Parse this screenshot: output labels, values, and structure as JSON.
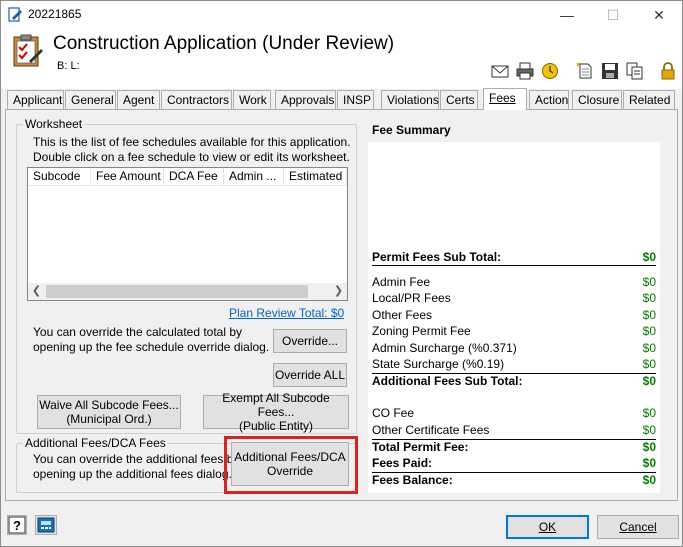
{
  "window": {
    "title": "20221865",
    "app_title": "Construction Application (Under Review)",
    "bl_label": "B: L:"
  },
  "toolbar_icons": [
    "envelope-icon",
    "printer-icon",
    "clock-icon",
    "new-document-icon",
    "save-icon",
    "copy-icon",
    "lock-icon"
  ],
  "tabs": [
    {
      "label": "Applicant"
    },
    {
      "label": "General"
    },
    {
      "label": "Agent"
    },
    {
      "label": "Contractors"
    },
    {
      "label": "Work"
    },
    {
      "label": "Approvals"
    },
    {
      "label": "INSP"
    },
    {
      "label": "Violations"
    },
    {
      "label": "Certs"
    },
    {
      "label": "Fees"
    },
    {
      "label": "Action"
    },
    {
      "label": "Closure"
    },
    {
      "label": "Related"
    }
  ],
  "active_tab": "Fees",
  "worksheet": {
    "group_label": "Worksheet",
    "desc1": "This is the list of fee schedules available for this application.",
    "desc2": "Double click on a fee schedule to view or edit its worksheet.",
    "columns": [
      "Subcode",
      "Fee Amount",
      "DCA Fee",
      "Admin ...",
      "Estimated"
    ],
    "plan_review_link": "Plan Review Total: $0",
    "override_text1": "You can override the calculated total by",
    "override_text2": "opening up the fee schedule override dialog.",
    "override_button": "Override...",
    "override_all_button": "Override ALL",
    "waive_button_line1": "Waive All Subcode Fees...",
    "waive_button_line2": "(Municipal Ord.)",
    "exempt_button_line1": "Exempt All Subcode Fees...",
    "exempt_button_line2": "(Public Entity)"
  },
  "additional_fees": {
    "group_label": "Additional Fees/DCA Fees",
    "text1": "You can override the additional fees by",
    "text2": "opening up the additional fees dialog.",
    "button_line1": "Additional Fees/DCA",
    "button_line2": "Override"
  },
  "fee_summary": {
    "title": "Fee Summary",
    "permit_sub_total": {
      "label": "Permit Fees Sub Total:",
      "value": "$0"
    },
    "rows1": [
      {
        "label": "Admin Fee",
        "value": "$0"
      },
      {
        "label": "Local/PR Fees",
        "value": "$0"
      },
      {
        "label": "Other Fees",
        "value": "$0"
      },
      {
        "label": "Zoning Permit Fee",
        "value": "$0"
      },
      {
        "label": "Admin Surcharge (%0.371)",
        "value": "$0"
      },
      {
        "label": "State Surcharge (%0.19)",
        "value": "$0"
      }
    ],
    "additional_sub_total": {
      "label": "Additional Fees Sub Total:",
      "value": "$0"
    },
    "rows2": [
      {
        "label": "CO Fee",
        "value": "$0"
      },
      {
        "label": "Other Certificate Fees",
        "value": "$0"
      }
    ],
    "total_permit_fee": {
      "label": "Total Permit Fee:",
      "value": "$0"
    },
    "fees_paid": {
      "label": "Fees Paid:",
      "value": "$0"
    },
    "fees_balance": {
      "label": "Fees Balance:",
      "value": "$0"
    }
  },
  "footer": {
    "ok": "OK",
    "cancel": "Cancel"
  },
  "colors": {
    "accent": "#0078d7",
    "highlight": "#e02020",
    "money": "#008000",
    "link": "#0066cc"
  }
}
